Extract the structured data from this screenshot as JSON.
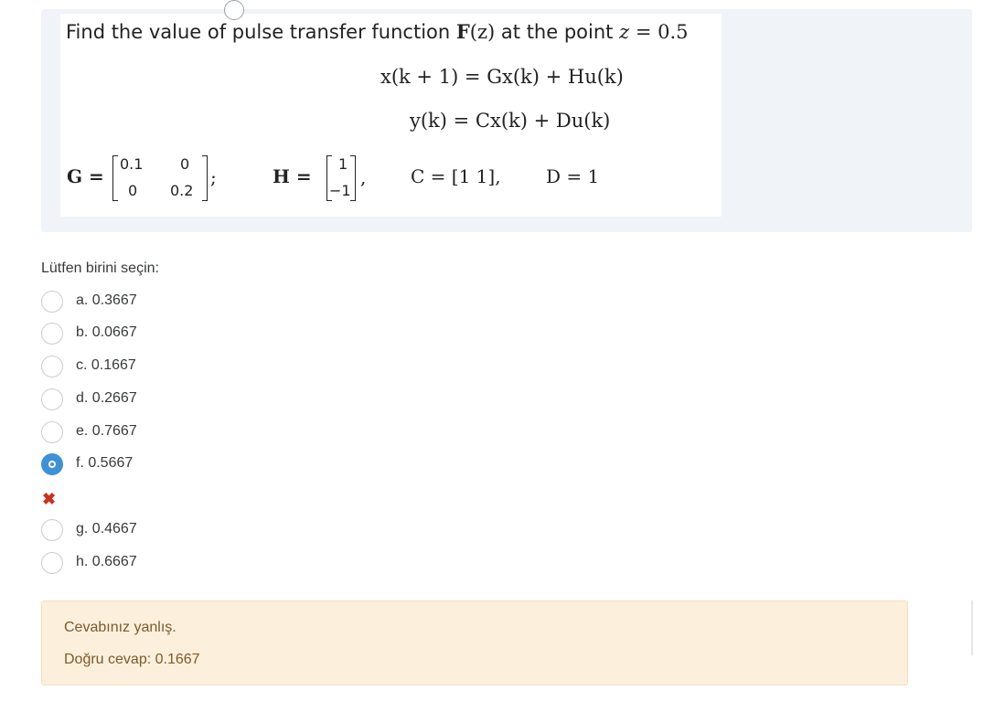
{
  "question": {
    "text_prefix": "Find the value of pulse transfer function ",
    "text_F": "F",
    "text_Fz": "(z)",
    "text_mid": " at the point ",
    "text_z": "z",
    "text_eq": " = 0.5",
    "eq1": "x(k + 1) = Gx(k) + Hu(k)",
    "eq2": "y(k) = Cx(k) + Du(k)",
    "G_label": "G =",
    "G_matrix": [
      "0.1",
      "0",
      "0",
      "0.2"
    ],
    "G_suffix": ";",
    "H_label": "H =",
    "H_matrix": [
      "1",
      "−1"
    ],
    "H_suffix": ",",
    "C_text": "C = [1   1],",
    "D_text": "D = 1"
  },
  "prompt": "Lütfen birini seçin:",
  "options": [
    {
      "label": "a. 0.3667",
      "selected": false
    },
    {
      "label": "b. 0.0667",
      "selected": false
    },
    {
      "label": "c. 0.1667",
      "selected": false
    },
    {
      "label": "d. 0.2667",
      "selected": false
    },
    {
      "label": "e. 0.7667",
      "selected": false
    },
    {
      "label": "f. 0.5667",
      "selected": true
    },
    {
      "label": "g. 0.4667",
      "selected": false
    },
    {
      "label": "h. 0.6667",
      "selected": false
    }
  ],
  "incorrect_mark": "✖",
  "feedback": {
    "result": "Cevabınız yanlış.",
    "correct": "Doğru cevap: 0.1667"
  },
  "colors": {
    "selected": "#3f91d7",
    "wrong": "#ca3120",
    "feedback_bg": "#fcefdc"
  }
}
